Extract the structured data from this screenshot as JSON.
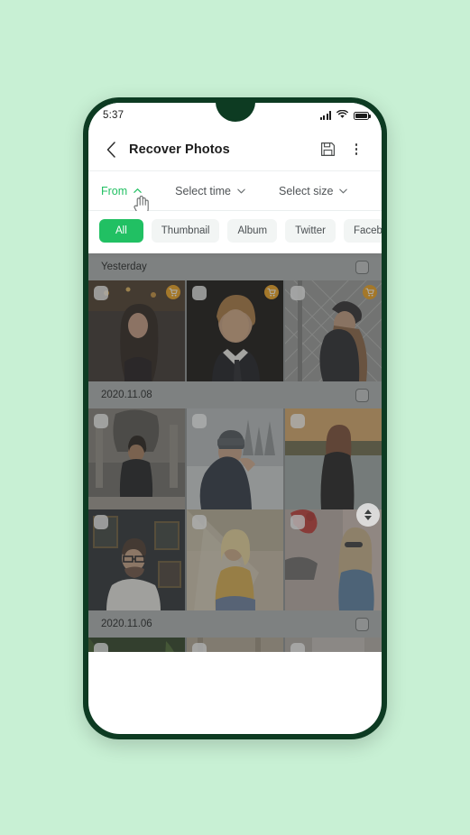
{
  "background_color": "#c8f0d4",
  "phone": {
    "frame_color": "#0d3b22",
    "screen_color": "#ffffff"
  },
  "status_bar": {
    "time": "5:37",
    "icons": [
      "signal-icon",
      "wifi-icon",
      "battery-icon"
    ]
  },
  "app_bar": {
    "back_icon": "chevron-left-icon",
    "title": "Recover Photos",
    "save_icon": "floppy-disk-icon",
    "menu_icon": "overflow-menu-icon"
  },
  "filter_bar": {
    "filters": [
      {
        "label": "From",
        "chevron": "chevron-up-icon",
        "active": true
      },
      {
        "label": "Select time",
        "chevron": "chevron-down-icon",
        "active": false
      },
      {
        "label": "Select size",
        "chevron": "chevron-down-icon",
        "active": false
      }
    ],
    "active_color": "#22c063",
    "cursor": "hand-pointer-cursor"
  },
  "tabs": {
    "selected": "All",
    "items": [
      {
        "label": "All",
        "selected": true
      },
      {
        "label": "Thumbnail",
        "selected": false
      },
      {
        "label": "Album",
        "selected": false
      },
      {
        "label": "Twitter",
        "selected": false
      },
      {
        "label": "Facebook",
        "selected": false
      }
    ],
    "selected_color": "#21c063"
  },
  "photo_list": {
    "scroll_handle": {
      "up_icon": "triangle-up-icon",
      "down_icon": "triangle-down-icon"
    },
    "groups": [
      {
        "date": "Yesterday",
        "group_checked": false,
        "photos": [
          {
            "alt": "woman-in-dark-sweater-cafe",
            "checked": false,
            "badge": "cart-icon"
          },
          {
            "alt": "man-in-suit-and-tie",
            "checked": false,
            "badge": "cart-icon"
          },
          {
            "alt": "woman-with-beret-by-fence",
            "checked": false,
            "badge": "cart-icon"
          }
        ]
      },
      {
        "date": "2020.11.08",
        "group_checked": false,
        "photos": [
          {
            "alt": "man-sitting-on-stone-steps",
            "checked": false,
            "badge": null
          },
          {
            "alt": "man-in-beanie-winter-street",
            "checked": false,
            "badge": null
          },
          {
            "alt": "woman-in-black-top-by-lake",
            "checked": false,
            "badge": null
          },
          {
            "alt": "man-with-glasses-dark-room",
            "checked": false,
            "badge": null
          },
          {
            "alt": "blonde-woman-in-yellow-sunlight",
            "checked": false,
            "badge": null
          },
          {
            "alt": "woman-in-sunglasses-on-street",
            "checked": false,
            "badge": null
          }
        ]
      },
      {
        "date": "2020.11.06",
        "group_checked": false,
        "photos": [
          {
            "alt": "bearded-man-red-cap-plants",
            "checked": false,
            "badge": null
          },
          {
            "alt": "woman-leaning-on-wooden-rail",
            "checked": false,
            "badge": null
          },
          {
            "alt": "woman-looking-up-grey-wall",
            "checked": false,
            "badge": null
          }
        ]
      }
    ]
  }
}
